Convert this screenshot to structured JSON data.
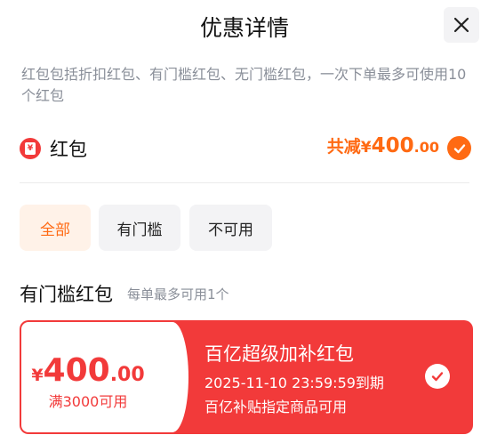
{
  "header": {
    "title": "优惠详情",
    "close_icon": "close-icon"
  },
  "description": "红包包括折扣红包、有门槛红包、无门槛红包，一次下单最多可使用10个红包",
  "redpacket": {
    "label": "红包",
    "total_prefix": "共减",
    "currency": "¥",
    "total_int": "400",
    "total_dec": ".00",
    "checked": true
  },
  "tabs": [
    {
      "label": "全部",
      "active": true
    },
    {
      "label": "有门槛",
      "active": false
    },
    {
      "label": "不可用",
      "active": false
    }
  ],
  "section": {
    "title": "有门槛红包",
    "subtitle": "每单最多可用1个"
  },
  "coupon": {
    "currency": "¥",
    "amount_int": "400",
    "amount_dec": ".00",
    "condition": "满3000可用",
    "title": "百亿超级加补红包",
    "expiry": "2025-11-10 23:59:59到期",
    "scope": "百亿补贴指定商品可用",
    "checked": true
  },
  "colors": {
    "accent": "#ff6a13",
    "red": "#f23a3a",
    "muted": "#8a8f99"
  }
}
